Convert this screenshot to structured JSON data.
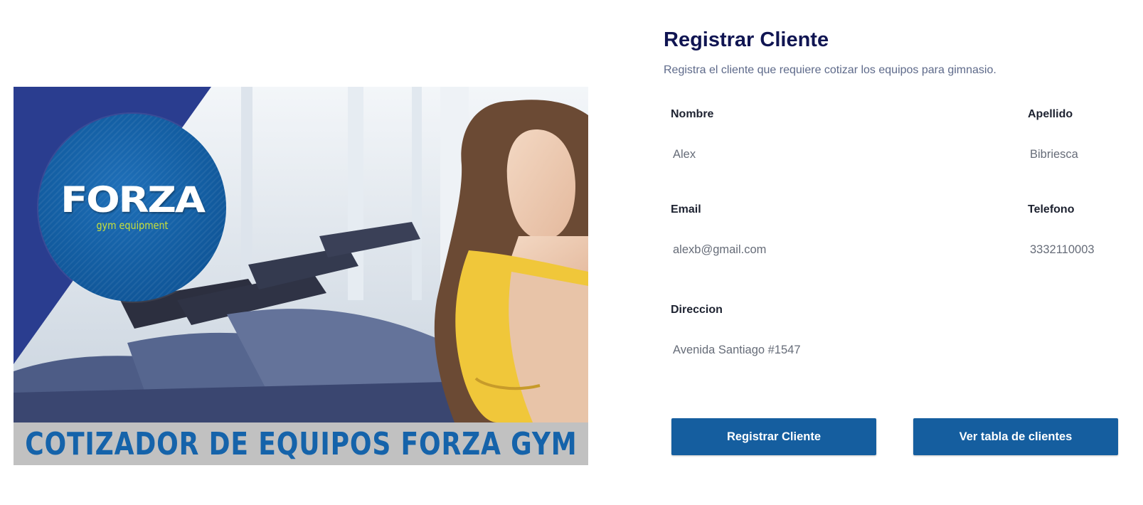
{
  "banner": {
    "logo_title": "FORZA",
    "logo_subtitle": "gym equipment",
    "caption": "COTIZADOR DE EQUIPOS FORZA GYM"
  },
  "form": {
    "title": "Registrar Cliente",
    "subtitle": "Registra el cliente que requiere cotizar los equipos para gimnasio.",
    "fields": {
      "nombre": {
        "label": "Nombre",
        "value": "Alex"
      },
      "apellido": {
        "label": "Apellido",
        "value": "Bibriesca"
      },
      "email": {
        "label": "Email",
        "value": "alexb@gmail.com"
      },
      "telefono": {
        "label": "Telefono",
        "value": "3332110003"
      },
      "direccion": {
        "label": "Direccion",
        "value": "Avenida Santiago #1547"
      }
    },
    "buttons": {
      "register": "Registrar Cliente",
      "view_table": "Ver tabla de clientes"
    }
  },
  "colors": {
    "primary_button": "#155e9f",
    "title": "#101552",
    "banner_blue": "#2a3d8f",
    "caption_text": "#1563aa",
    "caption_strip": "#c1c1c1"
  }
}
